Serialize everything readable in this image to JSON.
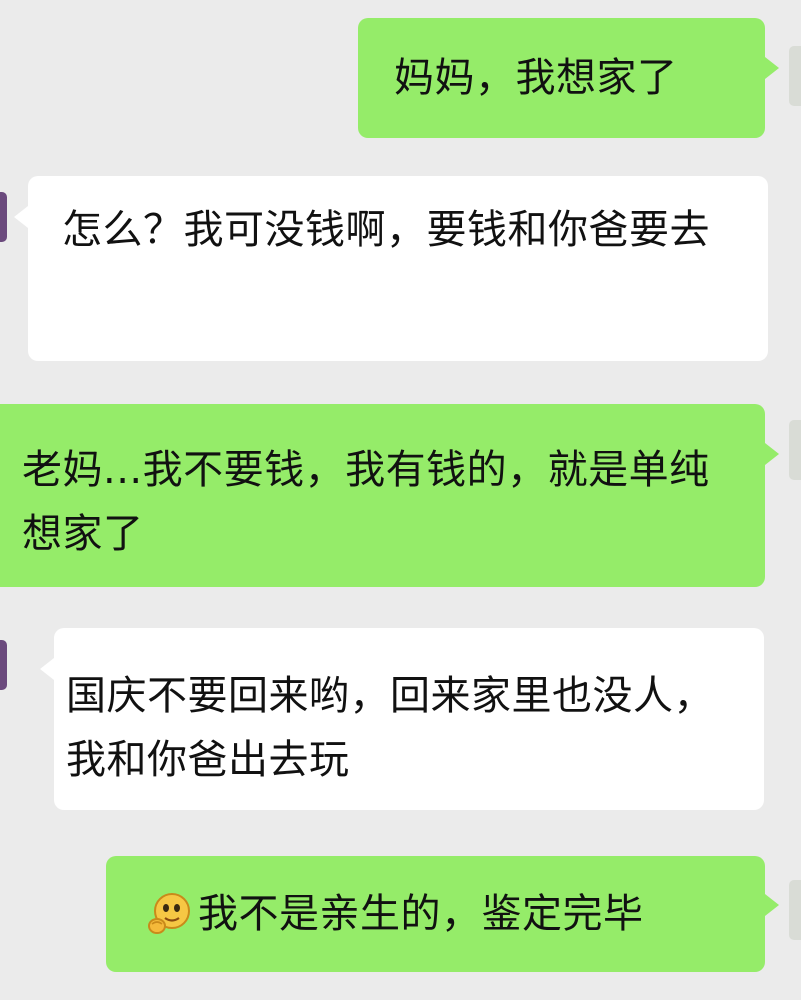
{
  "messages": [
    {
      "side": "right",
      "text": "妈妈，我想家了"
    },
    {
      "side": "left",
      "text": "怎么？我可没钱啊，要钱和你爸要去"
    },
    {
      "side": "right",
      "text": "老妈...我不要钱，我有钱的，就是单纯想家了"
    },
    {
      "side": "left",
      "text": "国庆不要回来哟，回来家里也没人，我和你爸出去玩"
    },
    {
      "side": "right",
      "text": "我不是亲生的，鉴定完毕",
      "emoji": "thinking-emoji"
    }
  ],
  "colors": {
    "background": "#ebebeb",
    "sent_bubble": "#95ec69",
    "received_bubble": "#ffffff"
  }
}
